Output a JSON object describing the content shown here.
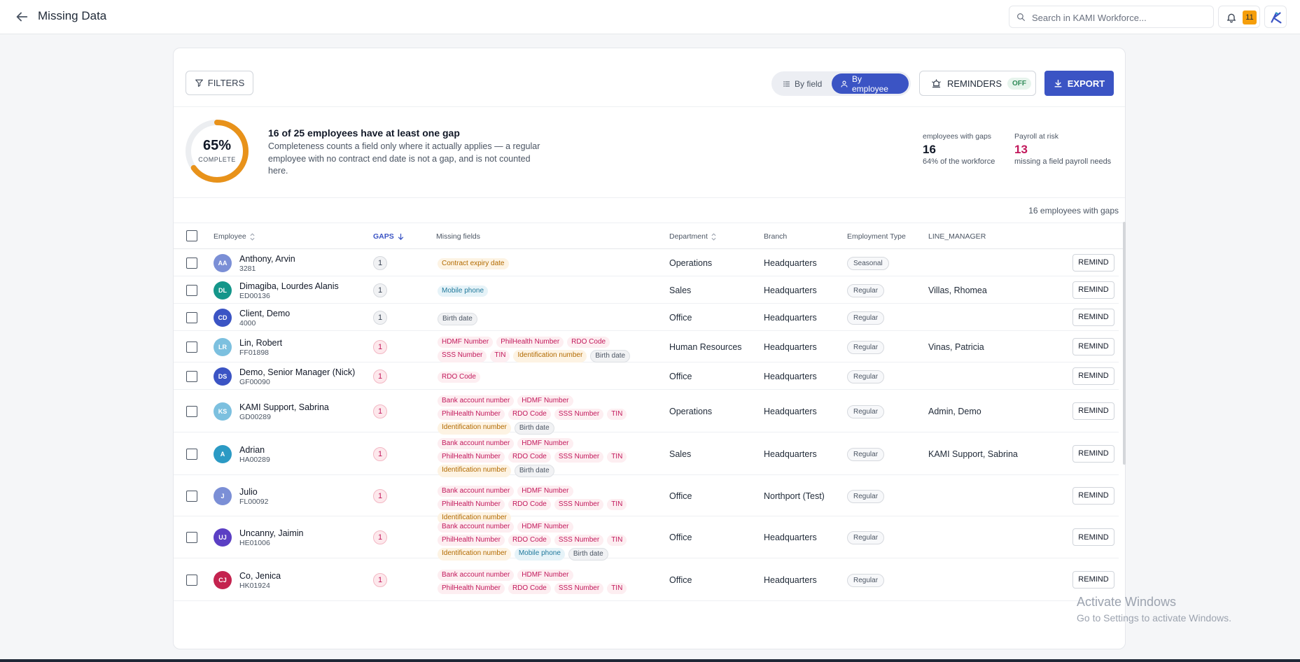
{
  "header": {
    "title": "Missing Data",
    "search_placeholder": "Search in KAMI Workforce...",
    "notification_count": "11"
  },
  "toolbar": {
    "filters_label": "FILTERS",
    "view_by_field": "By field",
    "view_by_employee": "By employee",
    "reminders_label": "REMINDERS",
    "reminders_state": "OFF",
    "export_label": "EXPORT"
  },
  "summary": {
    "completion_pct": "65%",
    "completion_value": 0.65,
    "completion_label": "COMPLETE",
    "headline": "16 of 25 employees have at least one gap",
    "description": "Completeness counts a field only where it actually applies — a regular employee with no contract end date is not a gap, and is not counted here.",
    "stat_gaps_label": "employees with gaps",
    "stat_gaps_value": "16",
    "stat_gaps_sub": "64% of the workforce",
    "stat_risk_label": "Payroll at risk",
    "stat_risk_value": "13",
    "stat_risk_sub": "missing a field payroll needs"
  },
  "table": {
    "count_text": "16 employees with gaps",
    "columns": {
      "employee": "Employee",
      "gaps": "GAPS",
      "missing": "Missing fields",
      "department": "Department",
      "branch": "Branch",
      "type": "Employment Type",
      "manager": "LINE_MANAGER"
    },
    "remind_label": "REMIND",
    "rows": [
      {
        "initials": "AA",
        "avatar_color": "#7b8fd6",
        "name": "Anthony, Arvin",
        "id": "3281",
        "gaps": "1",
        "risk": false,
        "fields": [
          {
            "t": "Contract expiry date",
            "c": "orange"
          }
        ],
        "department": "Operations",
        "branch": "Headquarters",
        "type": "Seasonal",
        "manager": ""
      },
      {
        "initials": "DL",
        "avatar_color": "#14968a",
        "name": "Dimagiba, Lourdes Alanis",
        "id": "ED00136",
        "gaps": "1",
        "risk": false,
        "fields": [
          {
            "t": "Mobile phone",
            "c": "blue"
          }
        ],
        "department": "Sales",
        "branch": "Headquarters",
        "type": "Regular",
        "manager": "Villas, Rhomea"
      },
      {
        "initials": "CD",
        "avatar_color": "#3b54c4",
        "name": "Client, Demo",
        "id": "4000",
        "gaps": "1",
        "risk": false,
        "fields": [
          {
            "t": "Birth date",
            "c": "gray"
          }
        ],
        "department": "Office",
        "branch": "Headquarters",
        "type": "Regular",
        "manager": ""
      },
      {
        "initials": "LR",
        "avatar_color": "#7cc0df",
        "name": "Lin, Robert",
        "id": "FF01898",
        "gaps": "1",
        "risk": true,
        "fields": [
          {
            "t": "HDMF Number",
            "c": "red"
          },
          {
            "t": "PhilHealth Number",
            "c": "red"
          },
          {
            "t": "RDO Code",
            "c": "red"
          },
          {
            "t": "SSS Number",
            "c": "red"
          },
          {
            "t": "TIN",
            "c": "red"
          },
          {
            "t": "Identification number",
            "c": "orange"
          },
          {
            "t": "Birth date",
            "c": "gray"
          }
        ],
        "department": "Human Resources",
        "branch": "Headquarters",
        "type": "Regular",
        "manager": "Vinas, Patricia"
      },
      {
        "initials": "DS",
        "avatar_color": "#3b54c4",
        "name": "Demo, Senior Manager (Nick)",
        "id": "GF00090",
        "gaps": "1",
        "risk": true,
        "fields": [
          {
            "t": "RDO Code",
            "c": "red"
          }
        ],
        "department": "Office",
        "branch": "Headquarters",
        "type": "Regular",
        "manager": ""
      },
      {
        "initials": "KS",
        "avatar_color": "#7cc0df",
        "name": "KAMI Support, Sabrina",
        "id": "GD00289",
        "gaps": "1",
        "risk": true,
        "fields": [
          {
            "t": "Bank account number",
            "c": "red"
          },
          {
            "t": "HDMF Number",
            "c": "red"
          },
          {
            "t": "PhilHealth Number",
            "c": "red"
          },
          {
            "t": "RDO Code",
            "c": "red"
          },
          {
            "t": "SSS Number",
            "c": "red"
          },
          {
            "t": "TIN",
            "c": "red"
          },
          {
            "t": "Identification number",
            "c": "orange"
          },
          {
            "t": "Birth date",
            "c": "gray"
          }
        ],
        "department": "Operations",
        "branch": "Headquarters",
        "type": "Regular",
        "manager": "Admin, Demo"
      },
      {
        "initials": "A",
        "avatar_color": "#2b9ac4",
        "name": "Adrian",
        "id": "HA00289",
        "gaps": "1",
        "risk": true,
        "fields": [
          {
            "t": "Bank account number",
            "c": "red"
          },
          {
            "t": "HDMF Number",
            "c": "red"
          },
          {
            "t": "PhilHealth Number",
            "c": "red"
          },
          {
            "t": "RDO Code",
            "c": "red"
          },
          {
            "t": "SSS Number",
            "c": "red"
          },
          {
            "t": "TIN",
            "c": "red"
          },
          {
            "t": "Identification number",
            "c": "orange"
          },
          {
            "t": "Birth date",
            "c": "gray"
          }
        ],
        "department": "Sales",
        "branch": "Headquarters",
        "type": "Regular",
        "manager": "KAMI Support, Sabrina"
      },
      {
        "initials": "J",
        "avatar_color": "#7b8fd6",
        "name": "Julio",
        "id": "FL00092",
        "gaps": "1",
        "risk": true,
        "fields": [
          {
            "t": "Bank account number",
            "c": "red"
          },
          {
            "t": "HDMF Number",
            "c": "red"
          },
          {
            "t": "PhilHealth Number",
            "c": "red"
          },
          {
            "t": "RDO Code",
            "c": "red"
          },
          {
            "t": "SSS Number",
            "c": "red"
          },
          {
            "t": "TIN",
            "c": "red"
          },
          {
            "t": "Identification number",
            "c": "orange"
          }
        ],
        "department": "Office",
        "branch": "Northport (Test)",
        "type": "Regular",
        "manager": ""
      },
      {
        "initials": "UJ",
        "avatar_color": "#5b3fc4",
        "name": "Uncanny, Jaimin",
        "id": "HE01006",
        "gaps": "1",
        "risk": true,
        "fields": [
          {
            "t": "Bank account number",
            "c": "red"
          },
          {
            "t": "HDMF Number",
            "c": "red"
          },
          {
            "t": "PhilHealth Number",
            "c": "red"
          },
          {
            "t": "RDO Code",
            "c": "red"
          },
          {
            "t": "SSS Number",
            "c": "red"
          },
          {
            "t": "TIN",
            "c": "red"
          },
          {
            "t": "Identification number",
            "c": "orange"
          },
          {
            "t": "Mobile phone",
            "c": "blue"
          },
          {
            "t": "Birth date",
            "c": "gray"
          }
        ],
        "department": "Office",
        "branch": "Headquarters",
        "type": "Regular",
        "manager": ""
      },
      {
        "initials": "CJ",
        "avatar_color": "#c4234f",
        "name": "Co, Jenica",
        "id": "HK01924",
        "gaps": "1",
        "risk": true,
        "fields": [
          {
            "t": "Bank account number",
            "c": "red"
          },
          {
            "t": "HDMF Number",
            "c": "red"
          },
          {
            "t": "PhilHealth Number",
            "c": "red"
          },
          {
            "t": "RDO Code",
            "c": "red"
          },
          {
            "t": "SSS Number",
            "c": "red"
          },
          {
            "t": "TIN",
            "c": "red"
          }
        ],
        "department": "Office",
        "branch": "Headquarters",
        "type": "Regular",
        "manager": ""
      }
    ]
  },
  "watermark": {
    "line1": "Activate Windows",
    "line2": "Go to Settings to activate Windows."
  },
  "colors": {
    "accent": "#3b54c4",
    "donut": "#e8921a",
    "risk": "#c2185b"
  }
}
